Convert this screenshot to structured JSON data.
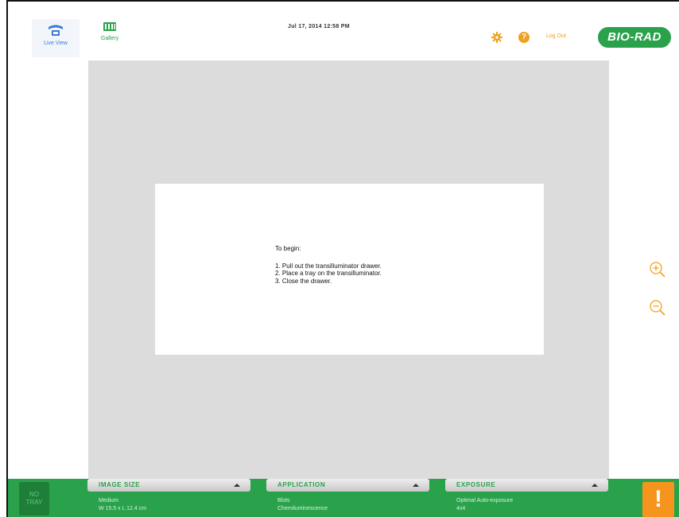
{
  "header": {
    "nav": [
      {
        "label": "Live View",
        "icon": "live-view-icon"
      },
      {
        "label": "Gallery",
        "icon": "gallery-icon"
      }
    ],
    "datetime": "Jul 17, 2014  12:58 PM",
    "settings_icon": "gear-icon",
    "help_label": "?",
    "logout_label": "Log Out",
    "logo_text": "BIO-RAD"
  },
  "main": {
    "message": {
      "title": "To begin:",
      "steps": [
        "1. Pull out the transilluminator drawer.",
        "2. Place a tray on the transilluminator.",
        "3. Close the drawer."
      ]
    },
    "zoom_in_icon": "zoom-in-icon",
    "zoom_out_icon": "zoom-out-icon"
  },
  "bottombar": {
    "tray_status": {
      "line1": "NO",
      "line2": "TRAY"
    },
    "panels": [
      {
        "title": "IMAGE SIZE",
        "line1": "Medium",
        "line2": "W 15.5 x L 12.4 cm"
      },
      {
        "title": "APPLICATION",
        "line1": "Blots",
        "line2": "Chemiluminescence"
      },
      {
        "title": "EXPOSURE",
        "line1": "Optimal Auto-exposure",
        "line2": "4x4"
      }
    ],
    "alert_label": "!"
  },
  "colors": {
    "brand_green": "#2aa14b",
    "accent_orange": "#f7941d",
    "help_orange": "#f0a020",
    "live_view_blue": "#3a7bd5",
    "viewport_gray": "#dcdcdc"
  }
}
